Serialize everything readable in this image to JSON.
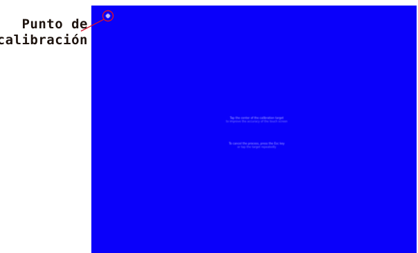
{
  "annotation": {
    "line1": "Punto de",
    "line2": "calibración"
  },
  "screen": {
    "background_color": "#0a00fa",
    "message_line_1": "Tap the center of the calibration target",
    "message_line_2": "to improve the accuracy of the touch screen",
    "message_line_3": "To cancel the process, press the Esc key",
    "message_line_4": "or tap the target repeatedly"
  },
  "colors": {
    "marker_ring": "#d8122f",
    "pointer_line": "#d8122f",
    "calibration_target": "#c8c8ff"
  }
}
